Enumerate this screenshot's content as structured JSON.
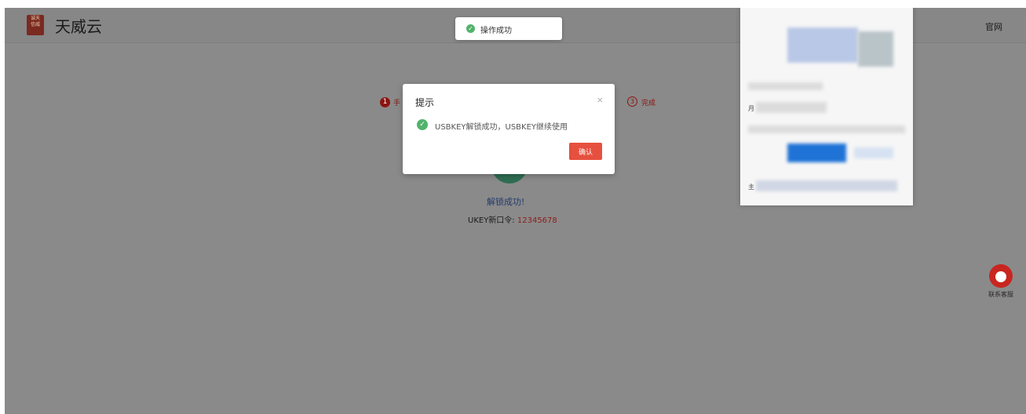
{
  "header": {
    "logo_text": "诚天\n信威",
    "brand": "天威云",
    "official_link": "官网"
  },
  "toast": {
    "icon": "check-circle-icon",
    "text": "操作成功"
  },
  "steps": {
    "step1_number": "1",
    "step1_label": "手",
    "step3_number": "3",
    "step3_label": "完成"
  },
  "result": {
    "title": "解锁成功!",
    "new_pin_label": "UKEY新口令:",
    "new_pin_value": "12345678"
  },
  "dialog": {
    "title": "提示",
    "close": "×",
    "message": "USBKEY解锁成功，USBKEY继续使用",
    "confirm_label": "确认"
  },
  "side_panel": {
    "close": "×",
    "row1_prefix": "月",
    "row2_prefix": "主"
  },
  "service": {
    "label": "联系客服"
  },
  "colors": {
    "overlay": "#8a8a8a",
    "success": "#52b36b",
    "confirm": "#e6503e",
    "brand_red": "#8b1410"
  }
}
